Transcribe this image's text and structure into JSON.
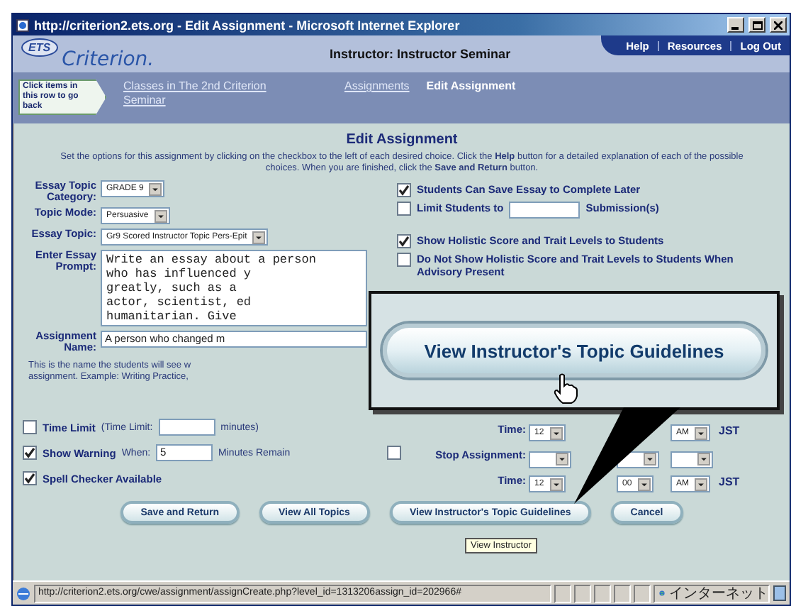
{
  "window": {
    "title": "http://criterion2.ets.org - Edit Assignment - Microsoft Internet Explorer"
  },
  "header": {
    "logo_badge": "ETS",
    "logo_text": "Criterion.",
    "instructor": "Instructor: Instructor Seminar",
    "links": [
      "Help",
      "Resources",
      "Log Out"
    ]
  },
  "breadcrumb": {
    "hint": "Click items in this row to go back",
    "items": [
      {
        "label": "Classes in The 2nd Criterion Seminar",
        "current": false
      },
      {
        "label": "Assignments",
        "current": false
      },
      {
        "label": "Edit Assignment",
        "current": true
      }
    ]
  },
  "page_title": "Edit Assignment",
  "instructions": "Set the options for this assignment by clicking on the checkbox to the left of each desired choice. Click the **Help** button for a detailed explanation of each of the possible choices. When you are finished, click the **Save and Return** button.",
  "left_fields": [
    {
      "kind": "select",
      "label": "Essay Topic Category:",
      "value": "GRADE 9"
    },
    {
      "kind": "select",
      "label": "Topic Mode:",
      "value": "Persuasive"
    },
    {
      "kind": "select",
      "label": "Essay Topic:",
      "value": "Gr9 Scored Instructor Topic Pers-Epit"
    },
    {
      "kind": "textarea",
      "label": "Enter Essay Prompt:",
      "lines": [
        "Write an essay about a person",
        "who has influenced y",
        "greatly, such as a",
        "actor, scientist, ed",
        "humanitarian. Give"
      ]
    },
    {
      "kind": "input",
      "label": "Assignment Name:",
      "value": "A person who changed m"
    }
  ],
  "name_help": [
    "This is the name the students will see w",
    "assignment. Example: Writing Practice,"
  ],
  "right_options": [
    {
      "kind": "check",
      "label": "Students Can Save Essay to Complete Later",
      "checked": true
    },
    {
      "kind": "limit",
      "label": "Limit Students to",
      "suffix": "Submission(s)",
      "checked": false
    },
    {
      "kind": "check",
      "label": "Show Holistic Score and Trait Levels to Students",
      "checked": true
    },
    {
      "kind": "check",
      "label": "Do Not Show Holistic Score and Trait Levels to Students When Advisory Present",
      "checked": false
    }
  ],
  "callout": {
    "button": "View Instructor's Topic Guidelines"
  },
  "time_options": [
    {
      "label": "Time Limit",
      "before": "(Time Limit:",
      "after": "minutes)",
      "checked": false
    },
    {
      "label": "Show Warning",
      "before": "When:",
      "value": "5",
      "after": "Minutes Remain",
      "checked": true
    },
    {
      "label": "Spell Checker Available",
      "checked": true
    }
  ],
  "schedule": [
    {
      "kind": "time",
      "label": "Time:",
      "hour": "12",
      "ampm": "AM",
      "zone": "JST"
    },
    {
      "kind": "stop",
      "label": "Stop Assignment:",
      "checked": false
    },
    {
      "kind": "time",
      "label": "Time:",
      "hour": "12",
      "minute": "00",
      "ampm": "AM",
      "zone": "JST"
    }
  ],
  "buttons": [
    "Save and Return",
    "View All Topics",
    "View Instructor's Topic Guidelines",
    "Cancel"
  ],
  "tooltip": "View Instructor",
  "status_bar": {
    "url": "http://criterion2.ets.org/cwe/assignment/assignCreate.php?level_id=1313206assign_id=202966#",
    "zone": "インターネット"
  }
}
